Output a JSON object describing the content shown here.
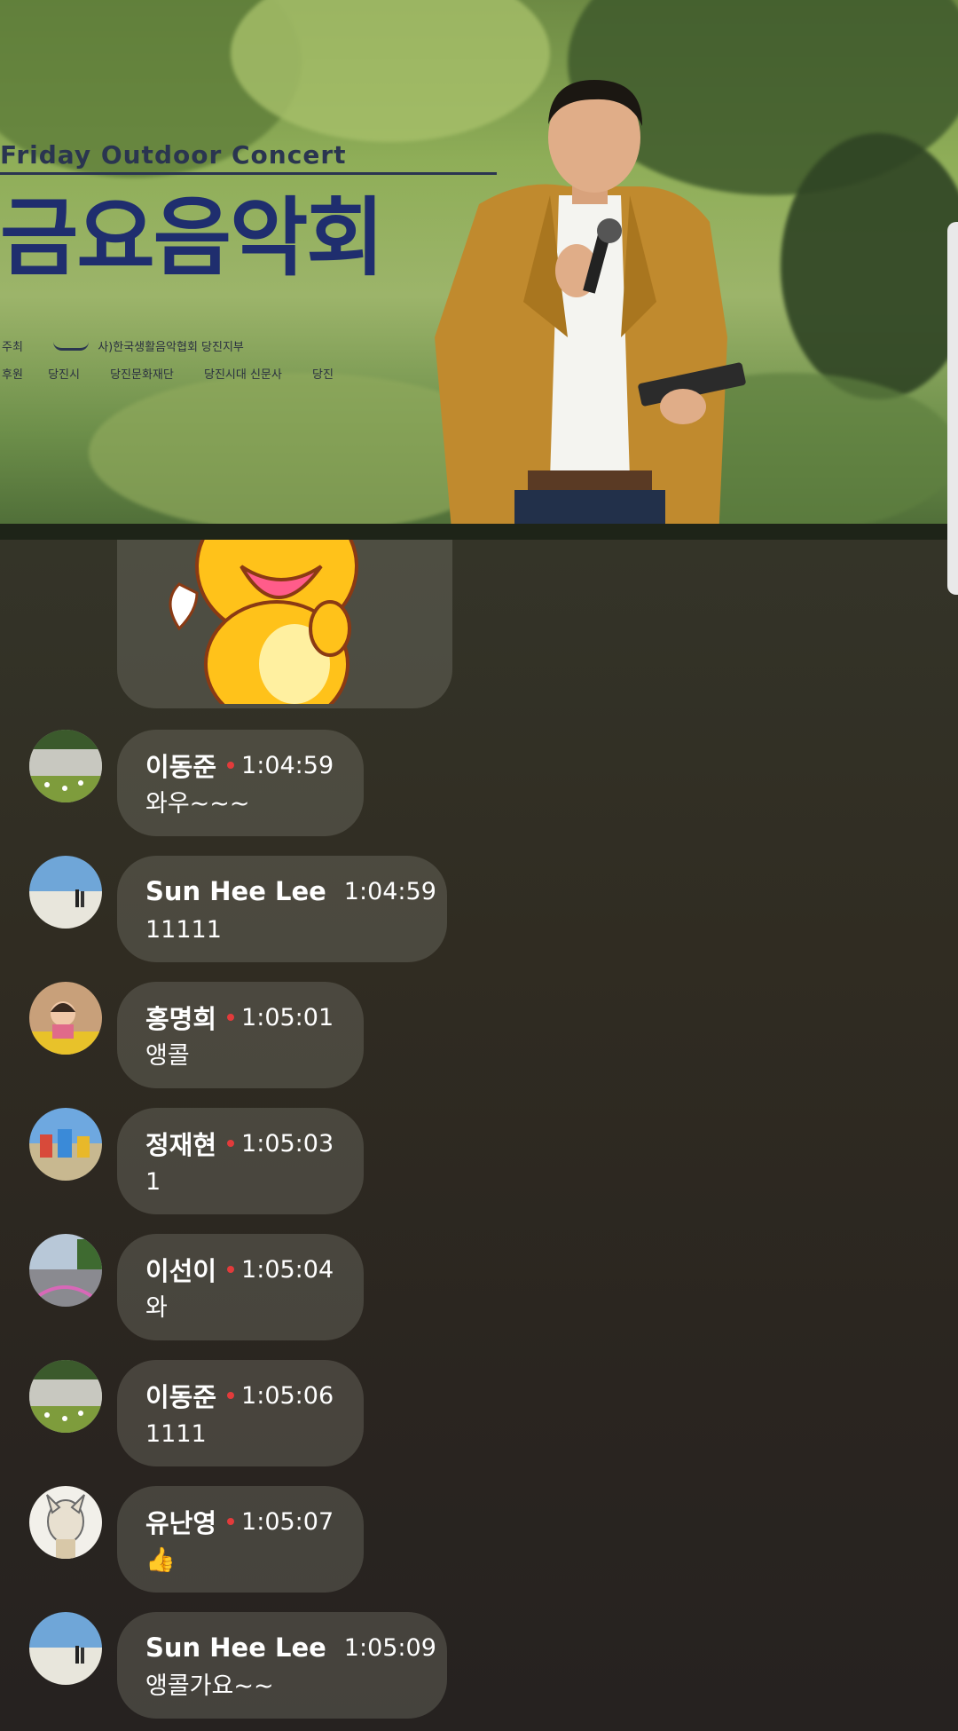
{
  "video": {
    "banner_title_en": "Friday Outdoor Concert",
    "banner_title_ko": "금요음악회",
    "host_label": "주최",
    "host_org": "사)한국생활음악협회 당진지부",
    "sponsor_label": "후원",
    "sponsors": [
      "당진시",
      "당진문화재단",
      "당진시대 신문사",
      "당진"
    ]
  },
  "chat": {
    "messages": [
      {
        "name": "이동준",
        "time": "1:04:59",
        "text": "와우~~~"
      },
      {
        "name": "Sun Hee Lee",
        "time": "1:04:59",
        "text": "11111"
      },
      {
        "name": "홍명희",
        "time": "1:05:01",
        "text": "앵콜"
      },
      {
        "name": "정재현",
        "time": "1:05:03",
        "text": "1"
      },
      {
        "name": "이선이",
        "time": "1:05:04",
        "text": "와"
      },
      {
        "name": "이동준",
        "time": "1:05:06",
        "text": "1111"
      },
      {
        "name": "유난영",
        "time": "1:05:07",
        "text": "👍"
      },
      {
        "name": "Sun Hee Lee",
        "time": "1:05:09",
        "text": "앵콜가요~~"
      }
    ]
  },
  "colors": {
    "bubble": "#78786e",
    "time_dot": "#e23b3b",
    "banner_blue": "#1f2e6e"
  }
}
